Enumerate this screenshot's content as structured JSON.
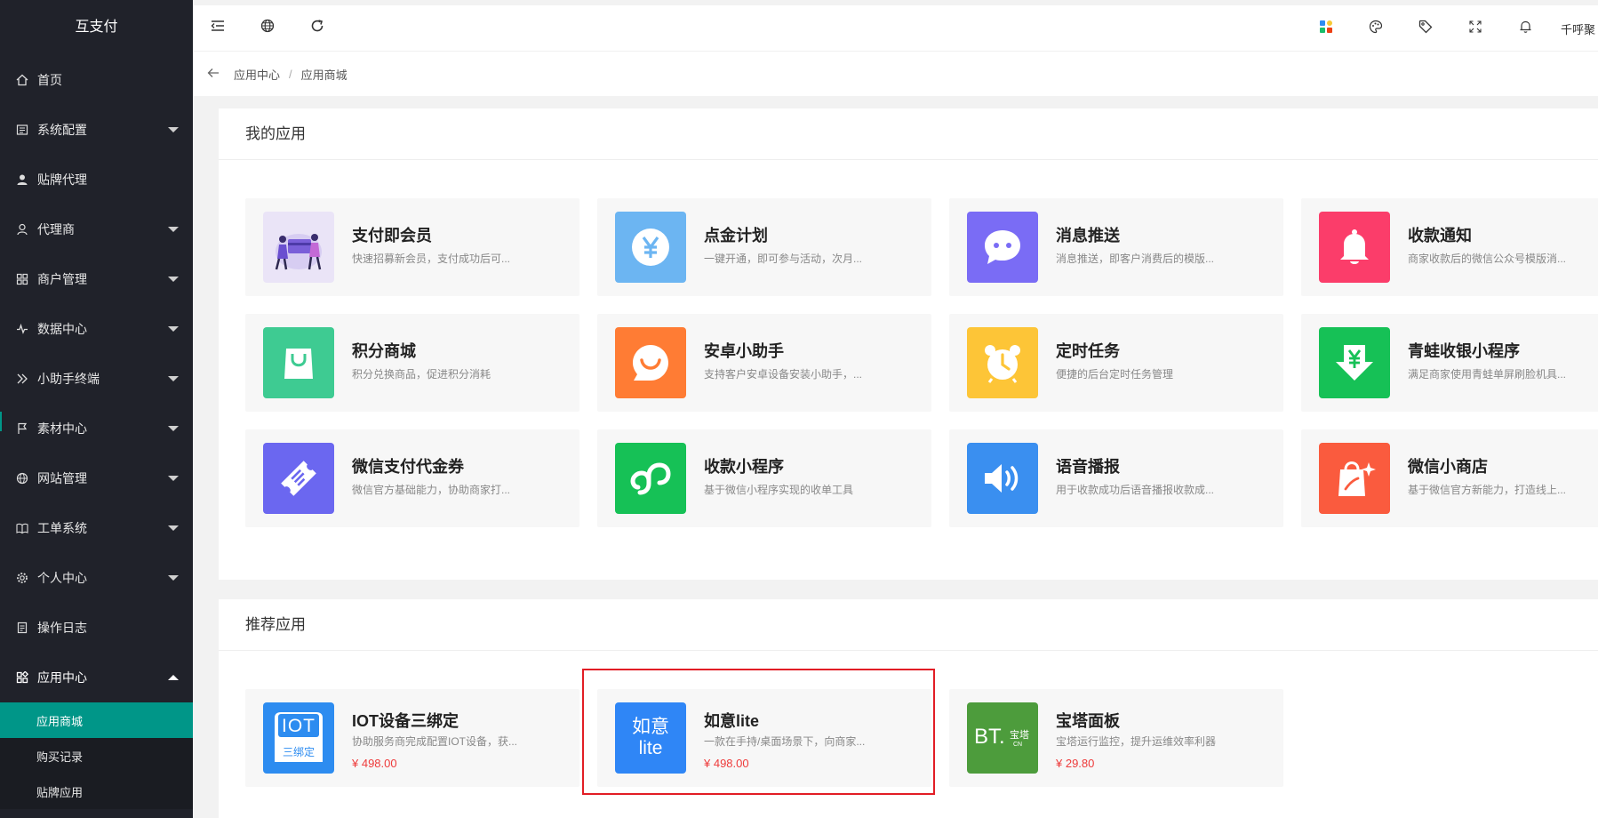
{
  "brand": "互支付",
  "sidebar": {
    "items": [
      {
        "label": "首页",
        "icon": "home-icon",
        "arrow": false
      },
      {
        "label": "系统配置",
        "icon": "config-icon",
        "arrow": true
      },
      {
        "label": "贴牌代理",
        "icon": "user-icon",
        "arrow": false
      },
      {
        "label": "代理商",
        "icon": "person-icon",
        "arrow": true
      },
      {
        "label": "商户管理",
        "icon": "merchant-icon",
        "arrow": true
      },
      {
        "label": "数据中心",
        "icon": "pulse-icon",
        "arrow": true
      },
      {
        "label": "小助手终端",
        "icon": "terminal-icon",
        "arrow": true
      },
      {
        "label": "素材中心",
        "icon": "flag-icon",
        "arrow": true
      },
      {
        "label": "网站管理",
        "icon": "globe-icon",
        "arrow": true
      },
      {
        "label": "工单系统",
        "icon": "book-icon",
        "arrow": true
      },
      {
        "label": "个人中心",
        "icon": "gear-icon",
        "arrow": true
      },
      {
        "label": "操作日志",
        "icon": "log-icon",
        "arrow": false
      },
      {
        "label": "应用中心",
        "icon": "apps-icon",
        "arrow": true
      }
    ],
    "submenu": [
      {
        "label": "应用商城",
        "active": true
      },
      {
        "label": "购买记录",
        "active": false
      },
      {
        "label": "贴牌应用",
        "active": false
      }
    ]
  },
  "header": {
    "user": "千呼聚"
  },
  "breadcrumb": {
    "parent": "应用中心",
    "sep": "/",
    "current": "应用商城"
  },
  "my_apps": {
    "title": "我的应用",
    "cards": [
      {
        "name": "支付即会员",
        "desc": "快速招募新会员，支付成功后可...",
        "color": "#eae4f7",
        "logo": "member-illustration-icon"
      },
      {
        "name": "点金计划",
        "desc": "一键开通，即可参与活动，次月...",
        "color": "#6cb5f2",
        "logo": "yuan-icon"
      },
      {
        "name": "消息推送",
        "desc": "消息推送，即客户消费后的模版...",
        "color": "#7a6cf5",
        "logo": "chat-bubble-icon"
      },
      {
        "name": "收款通知",
        "desc": "商家收款后的微信公众号模版消...",
        "color": "#fb3d6a",
        "logo": "bell-icon"
      },
      {
        "name": "积分商城",
        "desc": "积分兑换商品，促进积分消耗",
        "color": "#3ecb92",
        "logo": "shopping-bag-icon"
      },
      {
        "name": "安卓小助手",
        "desc": "支持客户安卓设备安装小助手，...",
        "color": "#ff7c34",
        "logo": "smile-bubble-icon"
      },
      {
        "name": "定时任务",
        "desc": "便捷的后台定时任务管理",
        "color": "#fdc537",
        "logo": "alarm-clock-icon"
      },
      {
        "name": "青蛙收银小程序",
        "desc": "满足商家使用青蛙单屏刷脸机具...",
        "color": "#16c156",
        "logo": "yuan-down-icon"
      },
      {
        "name": "微信支付代金券",
        "desc": "微信官方基础能力，协助商家打...",
        "color": "#6b67f0",
        "logo": "ticket-icon"
      },
      {
        "name": "收款小程序",
        "desc": "基于微信小程序实现的收单工具",
        "color": "#16c156",
        "logo": "mini-program-icon"
      },
      {
        "name": "语音播报",
        "desc": "用于收款成功后语音播报收款成...",
        "color": "#3a8ff0",
        "logo": "speaker-icon"
      },
      {
        "name": "微信小商店",
        "desc": "基于微信官方新能力，打造线上...",
        "color": "#fa5b3e",
        "logo": "shop-bag-icon"
      }
    ]
  },
  "recommended": {
    "title": "推荐应用",
    "cards": [
      {
        "name": "IOT设备三绑定",
        "desc": "协助服务商完成配置IOT设备，获...",
        "price": "¥ 498.00",
        "color": "#2d8cf0",
        "logo": "iot-icon",
        "logo_top": "IOT",
        "logo_bottom": "三绑定"
      },
      {
        "name": "如意lite",
        "desc": "一款在手持/桌面场景下，向商家...",
        "price": "¥ 498.00",
        "color": "#2f86f6",
        "logo": "ruyi-icon",
        "logo_top": "如意",
        "logo_bottom": "lite"
      },
      {
        "name": "宝塔面板",
        "desc": "宝塔运行监控，提升运维效率利器",
        "price": "¥ 29.80",
        "color": "#4d9c3c",
        "logo": "bt-icon",
        "logo_top": "BT.",
        "logo_bottom": "宝塔",
        "logo_sub": "CN"
      }
    ]
  }
}
